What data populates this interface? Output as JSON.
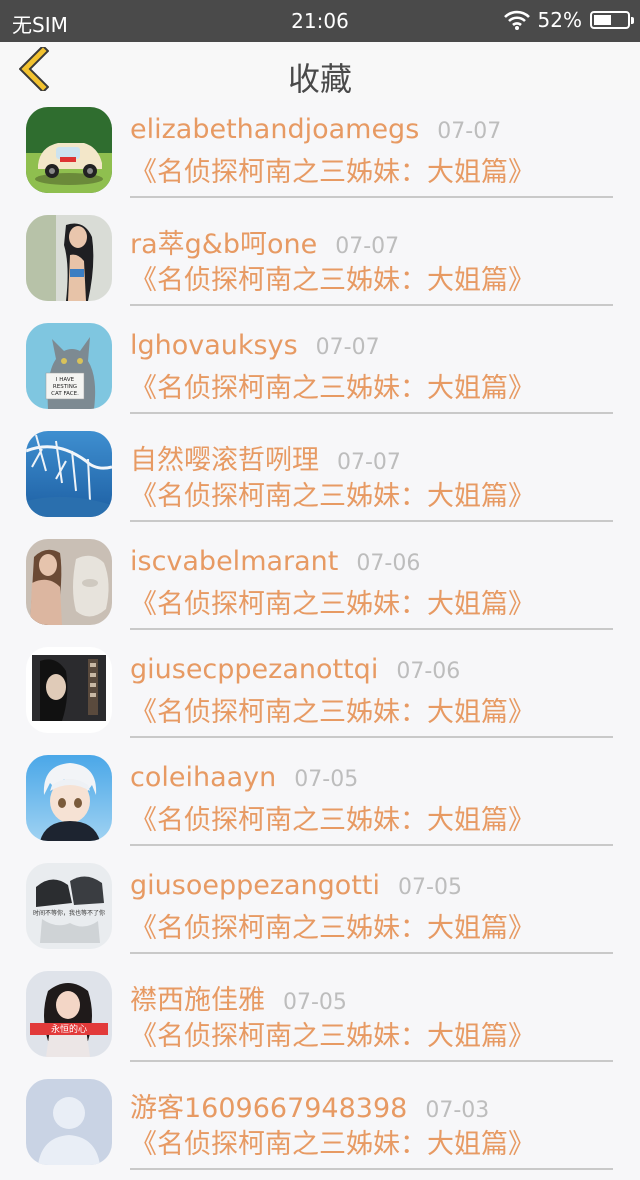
{
  "status_bar": {
    "carrier": "无SIM",
    "time": "21:06",
    "battery": "52%",
    "battery_level": 0.52,
    "wifi_icon": "wifi-icon",
    "battery_icon": "battery-icon"
  },
  "nav": {
    "title": "收藏",
    "back_icon": "chevron-left-icon",
    "back_color": "#f2c230"
  },
  "colors": {
    "accent": "#e79a63",
    "date": "#bdbdbd",
    "divider": "#c9c9c9"
  },
  "favorites": [
    {
      "user": "elizabethandjoamegs",
      "date": "07-07",
      "title": "《名侦探柯南之三姊妹：大姐篇》",
      "avatar": "toy-car-avatar"
    },
    {
      "user": "ra萃g&b呵one",
      "date": "07-07",
      "title": "《名侦探柯南之三姊妹：大姐篇》",
      "avatar": "woman-photo-avatar"
    },
    {
      "user": "lghovauksys",
      "date": "07-07",
      "title": "《名侦探柯南之三姊妹：大姐篇》",
      "avatar": "cat-sign-avatar",
      "avatar_sign": "I HAVE RESTING CAT FACE."
    },
    {
      "user": "自然嘤滚哲咧理",
      "date": "07-07",
      "title": "《名侦探柯南之三姊妹：大姐篇》",
      "avatar": "winter-tree-avatar"
    },
    {
      "user": "iscvabelmarant",
      "date": "07-06",
      "title": "《名侦探柯南之三姊妹：大姐篇》",
      "avatar": "woman-statue-avatar"
    },
    {
      "user": "giusecppezanottqi",
      "date": "07-06",
      "title": "《名侦探柯南之三姊妹：大姐篇》",
      "avatar": "dark-portrait-avatar"
    },
    {
      "user": "coleihaayn",
      "date": "07-05",
      "title": "《名侦探柯南之三姊妹：大姐篇》",
      "avatar": "anime-boy-avatar"
    },
    {
      "user": "giusoeppezangotti",
      "date": "07-05",
      "title": "《名侦探柯南之三姊妹：大姐篇》",
      "avatar": "hands-quote-avatar",
      "avatar_caption": "时间不等你，我也等不了你"
    },
    {
      "user": "襟西施佳雅",
      "date": "07-05",
      "title": "《名侦探柯南之三姊妹：大姐篇》",
      "avatar": "girl-banner-avatar",
      "avatar_caption": "永恒的心"
    },
    {
      "user": "游客1609667948398",
      "date": "07-03",
      "title": "《名侦探柯南之三姊妹：大姐篇》",
      "avatar": "default-user-avatar"
    }
  ]
}
